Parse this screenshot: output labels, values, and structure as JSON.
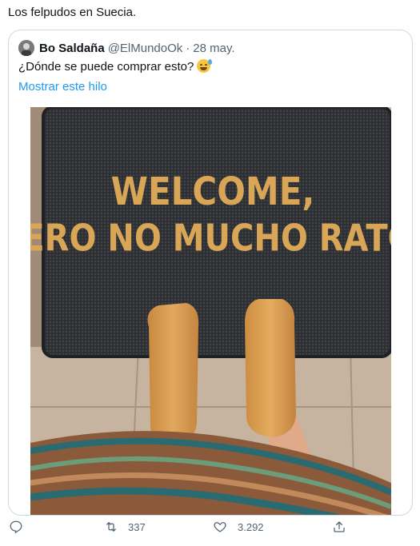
{
  "tweet": {
    "text": "Los felpudos en Suecia."
  },
  "quote": {
    "author_name": "Bo Saldaña",
    "author_handle": "@ElMundoOk",
    "separator": "·",
    "date": "28 may.",
    "text": "¿Dónde se puede comprar esto?",
    "emoji_icon": "sweat-smile-emoji",
    "show_thread_label": "Mostrar este hilo",
    "image": {
      "mat_text_line1": "WELCOME,",
      "mat_text_line2": "PERO NO MUCHO RATO.",
      "mat_text_color": "#d9a556",
      "mat_color": "#2f3135"
    }
  },
  "actions": {
    "reply": {
      "icon": "reply-icon"
    },
    "retweet": {
      "icon": "retweet-icon",
      "count": "337"
    },
    "like": {
      "icon": "heart-icon",
      "count": "3.292"
    },
    "share": {
      "icon": "share-icon"
    }
  },
  "colors": {
    "link": "#1d9bf0",
    "muted": "#536471",
    "border": "#cfd9de"
  }
}
